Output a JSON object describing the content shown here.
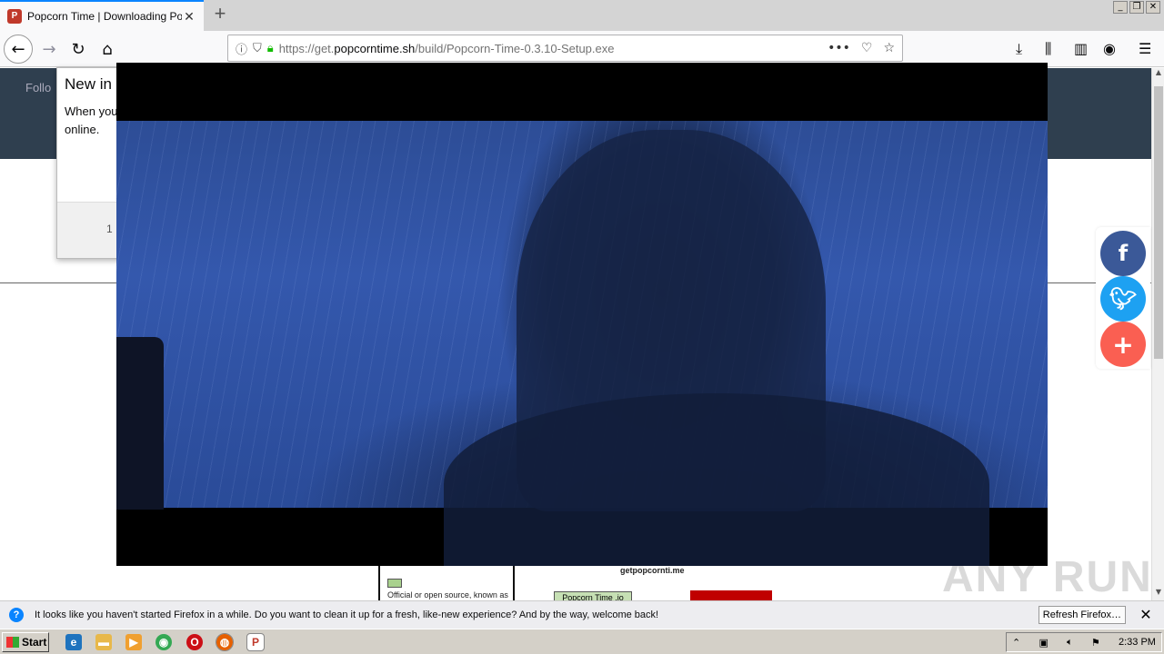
{
  "tab": {
    "title": "Popcorn Time | Downloading Popco",
    "favicon": "P"
  },
  "address": {
    "url_prefix": "https://get.",
    "url_domain": "popcorntime.sh",
    "url_path": "/build/Popcorn-Time-0.3.10-Setup.exe"
  },
  "page": {
    "follow_text": "Follo",
    "popup_title": "New in Content",
    "popup_body": "When you blocking p slow your online.",
    "popup_footer": "1"
  },
  "diagram": {
    "legend_text": "Official or open source, known as good versions",
    "site_label": "getpopcornti.me",
    "node_label": "Popcorn Time .io"
  },
  "watermark": "ANY RUN",
  "notification": {
    "message": "It looks like you haven't started Firefox in a while. Do you want to clean it up for a fresh, like-new experience? And by the way, welcome back!",
    "button": "Refresh Firefox…"
  },
  "taskbar": {
    "start_label": "Start",
    "clock": "2:33 PM"
  }
}
